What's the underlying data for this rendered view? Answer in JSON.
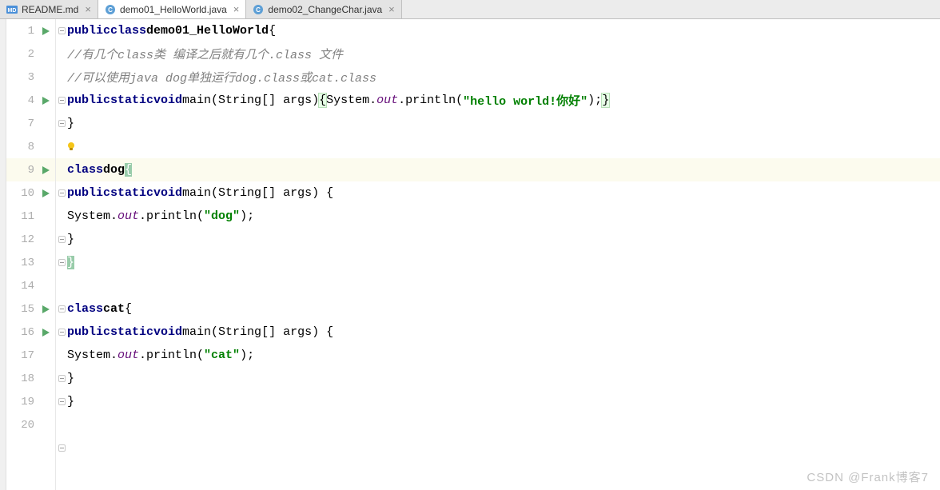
{
  "tabs": [
    {
      "label": "README.md",
      "type": "md",
      "active": false
    },
    {
      "label": "demo01_HelloWorld.java",
      "type": "java",
      "active": true
    },
    {
      "label": "demo02_ChangeChar.java",
      "type": "java",
      "active": false
    }
  ],
  "gutter": {
    "lines": [
      {
        "n": "1",
        "run": true
      },
      {
        "n": "2",
        "run": false
      },
      {
        "n": "3",
        "run": false
      },
      {
        "n": "4",
        "run": true
      },
      {
        "n": "7",
        "run": false
      },
      {
        "n": "8",
        "run": false
      },
      {
        "n": "9",
        "run": true,
        "hl": true
      },
      {
        "n": "10",
        "run": true
      },
      {
        "n": "11",
        "run": false
      },
      {
        "n": "12",
        "run": false
      },
      {
        "n": "13",
        "run": false
      },
      {
        "n": "14",
        "run": false
      },
      {
        "n": "15",
        "run": true
      },
      {
        "n": "16",
        "run": true
      },
      {
        "n": "17",
        "run": false
      },
      {
        "n": "18",
        "run": false
      },
      {
        "n": "19",
        "run": false
      },
      {
        "n": "20",
        "run": false
      }
    ]
  },
  "code": {
    "l1": {
      "public": "public",
      "class": "class",
      "name": "demo01_HelloWorld",
      "ob": "{"
    },
    "l2": {
      "comment": "//有几个class类 编译之后就有几个.class 文件"
    },
    "l3": {
      "comment": "//可以使用java dog单独运行dog.class或cat.class"
    },
    "l4": {
      "public": "public",
      "static": "static",
      "void": "void",
      "main": "main(String[] args)",
      "ob": "{",
      "sys": "System.",
      "out": "out",
      "pr": ".println(",
      "str": "\"hello world!你好\"",
      "end": ");",
      "cb": "}"
    },
    "l7": {
      "cb": "}"
    },
    "l9": {
      "class": "class",
      "name": "dog",
      "ob": "{"
    },
    "l10": {
      "public": "public",
      "static": "static",
      "void": "void",
      "main": "main(String[] args) {"
    },
    "l11": {
      "sys": "System.",
      "out": "out",
      "pr": ".println(",
      "str": "\"dog\"",
      "end": ");"
    },
    "l12": {
      "cb": "}"
    },
    "l13": {
      "cb": "}"
    },
    "l15": {
      "class": "class",
      "name": "cat",
      "ob": "{"
    },
    "l16": {
      "public": "public",
      "static": "static",
      "void": "void",
      "main": "main(String[] args) {"
    },
    "l17": {
      "sys": "System.",
      "out": "out",
      "pr": ".println(",
      "str": "\"cat\"",
      "end": ");"
    },
    "l18": {
      "cb": "}"
    },
    "l19": {
      "cb": "}"
    }
  },
  "watermark": "CSDN @Frank博客7"
}
